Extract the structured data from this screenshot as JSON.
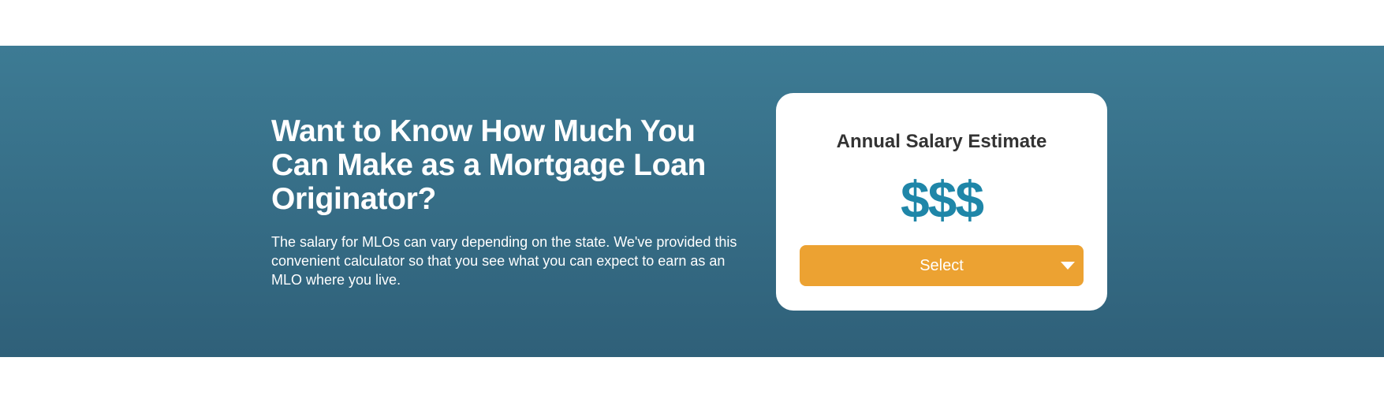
{
  "hero": {
    "headline": "Want to Know How Much You Can Make as a Mortgage Loan Originator?",
    "description": "The salary for MLOs can vary depending on the state. We've provided this convenient calculator so that you see what you can expect to earn as an MLO where you live."
  },
  "calculator": {
    "title": "Annual Salary Estimate",
    "amount": "$$$",
    "select_label": "Select",
    "chevron_icon": "chevron-down-icon"
  },
  "colors": {
    "hero_gradient_top": "#3d7b94",
    "hero_gradient_bottom": "#2f6079",
    "amount": "#1f86a8",
    "select_button": "#eca232"
  }
}
